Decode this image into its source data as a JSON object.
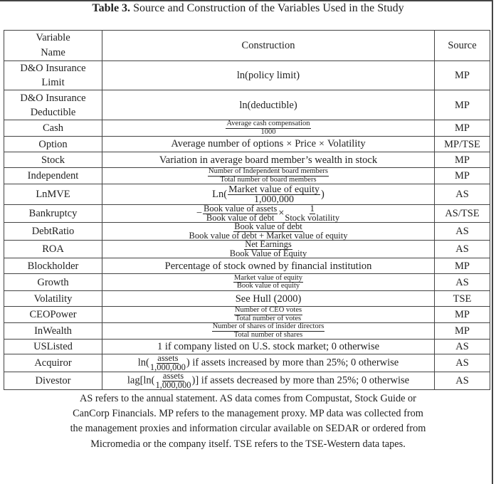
{
  "caption": {
    "label": "Table 3.",
    "title": " Source and Construction of the Variables Used in the Study"
  },
  "table": {
    "headers": {
      "variable_line1": "Variable",
      "variable_line2": "Name",
      "construction": "Construction",
      "source": "Source"
    },
    "rows": [
      {
        "name_line1": "D&O Insurance",
        "name_line2": "Limit",
        "construction": "ln(policy limit)",
        "source": "MP"
      },
      {
        "name_line1": "D&O Insurance",
        "name_line2": "Deductible",
        "construction": "ln(deductible)",
        "source": "MP"
      },
      {
        "name": "Cash",
        "num": "Average cash compensation",
        "den": "1000",
        "source": "MP"
      },
      {
        "name": "Option",
        "p1": "Average number of options",
        "times": "×",
        "p2": "Price",
        "p3": "Volatility",
        "source": "MP/TSE"
      },
      {
        "name": "Stock",
        "construction": "Variation in average board member’s wealth in stock",
        "source": "MP"
      },
      {
        "name": "Independent",
        "num": "Number of Independent board members",
        "den": "Total number of board members",
        "source": "MP"
      },
      {
        "name": "LnMVE",
        "prefix": "Ln(",
        "num": "Market value of equity",
        "den": "1,000,000",
        "suffix": ")",
        "source": "AS"
      },
      {
        "name": "Bankruptcy",
        "minus": "−",
        "num1": "Book value of assets",
        "den1": "Book value of debt",
        "times": "×",
        "num2": "1",
        "den2": "Stock volatility",
        "source": "AS/TSE"
      },
      {
        "name": "DebtRatio",
        "num": "Book value of debt",
        "den": "Book value of debt + Market value of equity",
        "source": "AS"
      },
      {
        "name": "ROA",
        "num": "Net Earnings",
        "den": "Book Value of Equity",
        "source": "AS"
      },
      {
        "name": "Blockholder",
        "construction": "Percentage of stock owned by financial institution",
        "source": "MP"
      },
      {
        "name": "Growth",
        "num": "Market value of equity",
        "den": "Book value of equity",
        "source": "AS"
      },
      {
        "name": "Volatility",
        "construction": "See Hull (2000)",
        "source": "TSE"
      },
      {
        "name": "CEOPower",
        "num": "Number of CEO votes",
        "den": "Total number of votes",
        "source": "MP"
      },
      {
        "name": "InWealth",
        "num": "Number of shares of insider directors",
        "den": "Total number of shares",
        "source": "MP"
      },
      {
        "name": "USListed",
        "construction": "1 if company listed on U.S. stock market; 0 otherwise",
        "source": "AS"
      },
      {
        "name": "Acquiror",
        "prefix": "ln(",
        "num": "assets",
        "den": "1,000,000",
        "suffix": ") if assets increased by more than 25%; 0 otherwise",
        "source": "AS"
      },
      {
        "name": "Divestor",
        "prefix": "lag[ln(",
        "num": "assets",
        "den": "1,000,000",
        "suffix": ")] if assets decreased by more than 25%; 0 otherwise",
        "source": "AS"
      }
    ]
  },
  "note": "AS refers to the annual statement. AS data comes from Compustat, Stock Guide or CanCorp Financials. MP refers to the management proxy. MP data was collected from the management proxies and information circular available on SEDAR or ordered from Micromedia or the company itself. TSE refers to the TSE-Western data tapes."
}
